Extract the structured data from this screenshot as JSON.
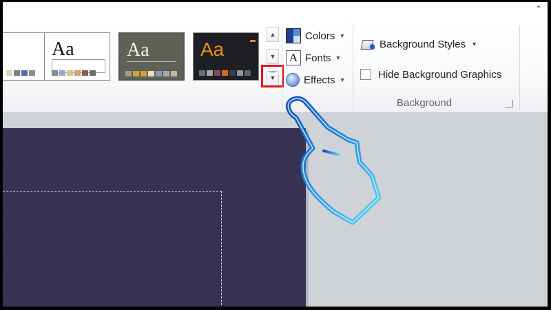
{
  "ribbon": {
    "theme_variants": [
      {
        "name": "",
        "sample_text": "",
        "swatches": [
          "#e0d2b7",
          "#7f7f7f",
          "#4f6fa8",
          "#8c8c8c"
        ]
      },
      {
        "name": "",
        "sample_text": "Aa",
        "swatches": [
          "#7d8a99",
          "#9caac9",
          "#d8c58e",
          "#c9a27a",
          "#8a5f52",
          "#6e6e6e"
        ]
      },
      {
        "name": "",
        "sample_text": "Aa",
        "swatches": [
          "#a09d8e",
          "#c9a83f",
          "#d99a2f",
          "#e6e0c0",
          "#8e9aa8",
          "#b0a2b8",
          "#c5b3a0"
        ]
      },
      {
        "name": "",
        "sample_text": "Aa",
        "swatches": [
          "#6b7179",
          "#a3a9b2",
          "#7b4b6c",
          "#d86b1a",
          "#3a3f47",
          "#8d9aa4",
          "#5f6670"
        ]
      }
    ],
    "themes_group": {
      "colors_label": "Colors",
      "fonts_label": "Fonts",
      "effects_label": "Effects"
    },
    "background_group": {
      "background_styles_label": "Background Styles",
      "hide_graphics_label": "Hide Background Graphics",
      "hide_graphics_checked": false,
      "group_label": "Background"
    }
  },
  "icons": {
    "collapse": "chevron-up-icon",
    "scroll_up": "scroll-up-icon",
    "scroll_down": "scroll-down-icon",
    "more": "more-icon",
    "colors": "theme-colors-icon",
    "fonts": "theme-fonts-icon",
    "effects": "theme-effects-icon",
    "background_styles": "paint-bucket-icon",
    "pointer": "hand-pointer-icon"
  },
  "colors": {
    "highlight": "#e0141e",
    "slide_background": "#363151",
    "workspace": "#cfd2d6"
  }
}
